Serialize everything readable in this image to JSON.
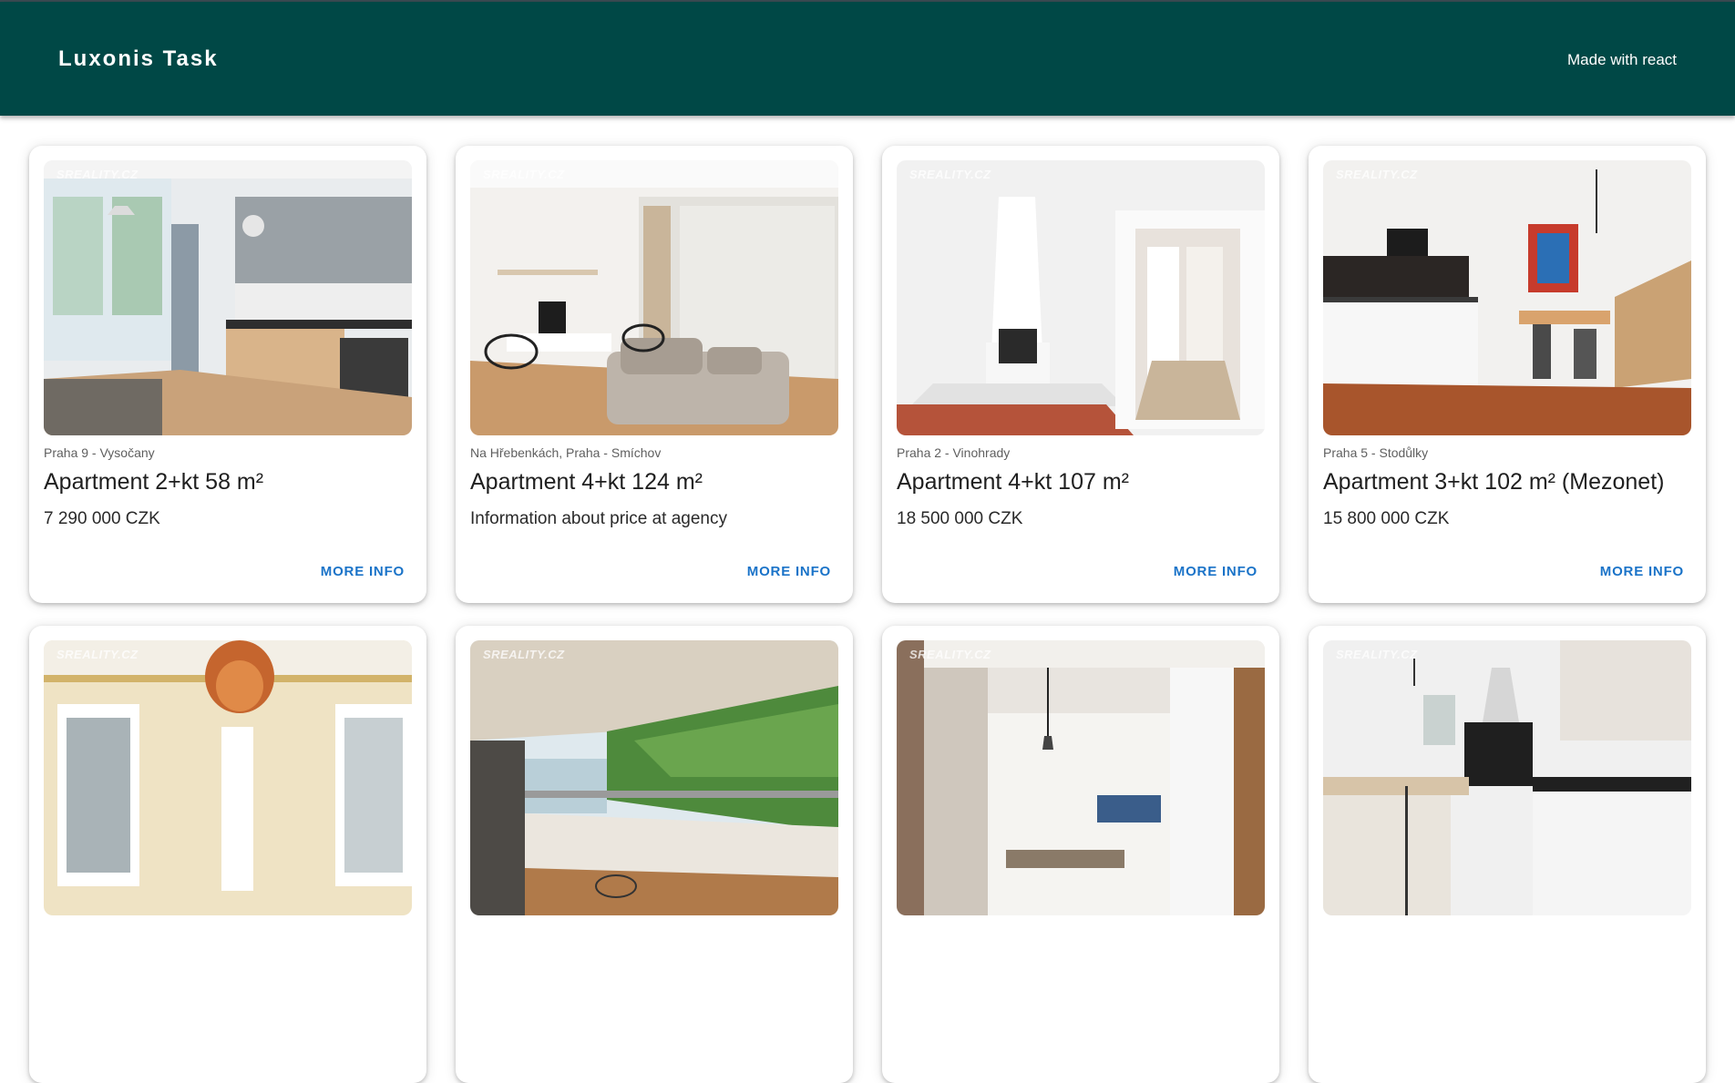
{
  "appbar": {
    "title": "Luxonis Task",
    "made_with": "Made with react"
  },
  "colors": {
    "appbar": "#004846",
    "link": "#1a73c8"
  },
  "watermark": "SREALITY.CZ",
  "listings": [
    {
      "location": "Praha 9 - Vysočany",
      "title": "Apartment 2+kt 58 m²",
      "price": "7 290 000 CZK",
      "more_label": "MORE INFO"
    },
    {
      "location": "Na Hřebenkách, Praha - Smíchov",
      "title": "Apartment 4+kt 124 m²",
      "price": "Information about price at agency",
      "more_label": "MORE INFO"
    },
    {
      "location": "Praha 2 - Vinohrady",
      "title": "Apartment 4+kt 107 m²",
      "price": "18 500 000 CZK",
      "more_label": "MORE INFO"
    },
    {
      "location": "Praha 5 - Stodůlky",
      "title": "Apartment 3+kt 102 m² (Mezonet)",
      "price": "15 800 000 CZK",
      "more_label": "MORE INFO"
    },
    {
      "location": "",
      "title": "",
      "price": "",
      "more_label": ""
    },
    {
      "location": "",
      "title": "",
      "price": "",
      "more_label": ""
    },
    {
      "location": "",
      "title": "",
      "price": "",
      "more_label": ""
    },
    {
      "location": "",
      "title": "",
      "price": "",
      "more_label": ""
    }
  ]
}
